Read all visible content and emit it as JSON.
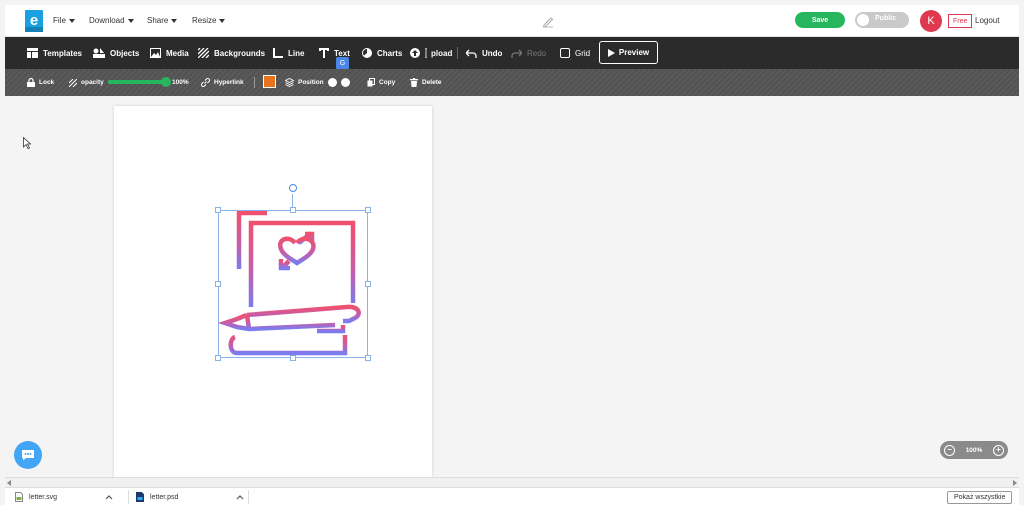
{
  "menu": {
    "file": "File",
    "download": "Download",
    "share": "Share",
    "resize": "Resize"
  },
  "header": {
    "save_label": "Save",
    "public_label": "Public",
    "avatar_letter": "K",
    "plan_badge": "Free",
    "logout_label": "Logout"
  },
  "toolbar": {
    "templates": "Templates",
    "objects": "Objects",
    "media": "Media",
    "backgrounds": "Backgrounds",
    "line": "Line",
    "text": "Text",
    "charts": "Charts",
    "upload": "pload",
    "undo": "Undo",
    "redo": "Redo",
    "grid": "Grid",
    "preview": "Preview"
  },
  "properties": {
    "lock": "Lock",
    "opacity_label": "opacity",
    "opacity_value": "100%",
    "opacity_fraction": 1.0,
    "hyperlink": "Hyperlink",
    "fill_color": "#e8731f",
    "position": "Position",
    "copy": "Copy",
    "delete": "Delete"
  },
  "canvas": {
    "zoom_value": "100%",
    "icon_name": "love-letter-scroll-icon"
  },
  "downloads": {
    "files": [
      {
        "name": "letter.svg",
        "icon": "svg-file-icon"
      },
      {
        "name": "letter.psd",
        "icon": "psd-file-icon"
      }
    ],
    "show_all": "Pokaż wszystkie"
  },
  "colors": {
    "accent_green": "#27b65e",
    "brand_red": "#e0384f",
    "toolbar_bg": "#2b2b2b",
    "gradient_top": "#f0516e",
    "gradient_bottom": "#7b7cf0"
  }
}
